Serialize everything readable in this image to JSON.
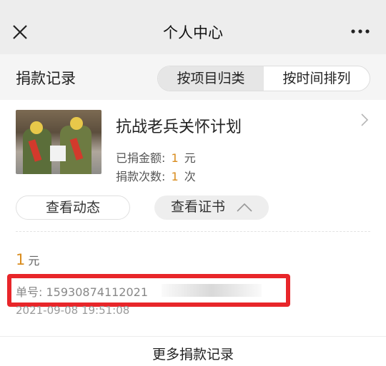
{
  "nav": {
    "title": "个人中心",
    "close_icon": "close-icon",
    "more_icon": "more-dots-icon"
  },
  "header": {
    "label": "捐款记录",
    "toggle": {
      "by_project": "按项目归类",
      "by_time": "按时间排列",
      "selected": "按项目归类"
    }
  },
  "project": {
    "title": "抗战老兵关怀计划",
    "donated_label": "已捐金额:",
    "donated_value": "1",
    "donated_unit": "元",
    "count_label": "捐款次数:",
    "count_value": "1",
    "count_unit": "次",
    "btn_activity": "查看动态",
    "btn_certificate": "查看证书"
  },
  "record": {
    "amount": "1",
    "amount_unit": "元",
    "order_label": "单号:",
    "order_no": "15930874112021",
    "time": "2021-09-08 19:51:08"
  },
  "footer": {
    "more_label": "更多捐款记录"
  },
  "colors": {
    "accent": "#d98c1e",
    "highlight": "#e8262a"
  }
}
